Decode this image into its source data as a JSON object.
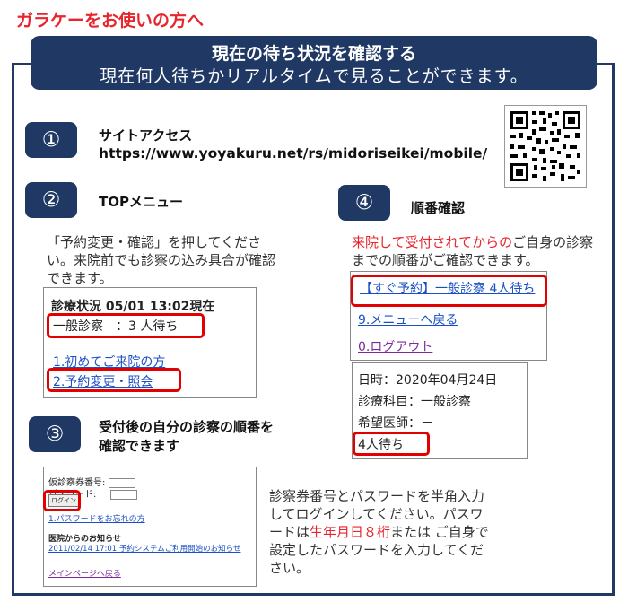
{
  "header": {
    "page_title": "ガラケーをお使いの方へ",
    "banner_title": "現在の待ち状況を確認する",
    "banner_subtitle": "現在何人待ちかリアルタイムで見ることができます。"
  },
  "step1": {
    "number": "①",
    "title": "サイトアクセス",
    "url": "https://www.yoyakuru.net/rs/midoriseikei/mobile/"
  },
  "step2": {
    "number": "②",
    "title": "TOPメニュー",
    "text": "「予約変更・確認」を押してください。来院前でも診察の込み具合が確認できます。",
    "screen": {
      "status": "診療状況 05/01 13:02現在",
      "waiting": "一般診察　：3 人待ち",
      "link1": "1.初めてご来院の方",
      "link2": "2.予約変更・照会"
    }
  },
  "step3": {
    "number": "③",
    "title": "受付後の自分の診察の順番を確認できます",
    "screen": {
      "ticket_label": "仮診察券番号:",
      "password_label": "パスワード:",
      "login_button": "ログイン",
      "forgot_link": "1.パスワードをお忘れの方",
      "notice_heading": "医院からのお知らせ",
      "notice_link": "2011/02/14 17:01 予約システムご利用開始のお知らせ",
      "main_link": "メインページへ戻る"
    },
    "text_before": "診察券番号とパスワードを半角入力してログインしてください。パスワードは",
    "text_red": "生年月日８桁",
    "text_after": "または ご自身で設定したパスワードを入力してください。"
  },
  "step4": {
    "number": "④",
    "title": "順番確認",
    "text_red": "来院して受付されてからの",
    "text_rest": "ご自身の診察までの順番がご確認できます。",
    "screen": {
      "link_now": "【すぐ予約】一般診察 4人待ち",
      "link_menu": "9.メニューへ戻る",
      "link_logout": "0.ログアウト",
      "date": "日時：2020年04月24日",
      "dept": "診療科目：一般診察",
      "doctor": "希望医師：－",
      "waiting": "4人待ち"
    }
  },
  "colors": {
    "navy": "#1f3864",
    "red": "#e8252d",
    "link": "#1a4fc4"
  },
  "icons": {
    "qr": "qr-code-icon"
  }
}
